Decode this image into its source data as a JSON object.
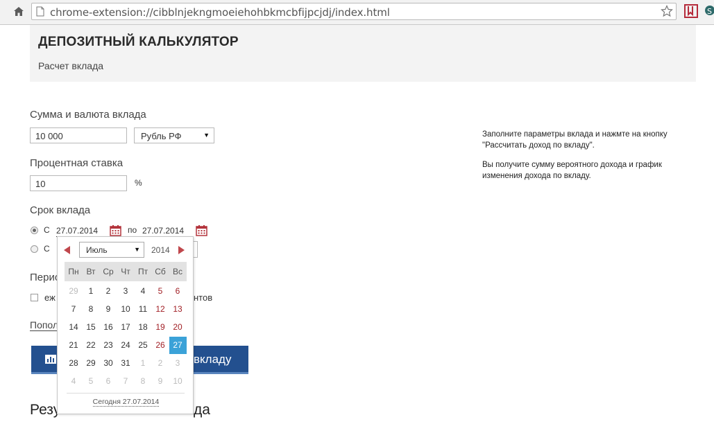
{
  "browser": {
    "url": "chrome-extension://cibblnjekngmoeiehohbkmcbfijpcjdj/index.html",
    "icons": [
      "home-icon",
      "page-icon",
      "star-icon",
      "bookmark-ext-icon",
      "extension-icon"
    ]
  },
  "header": {
    "title": "ДЕПОЗИТНЫЙ КАЛЬКУЛЯТОР",
    "subtitle": "Расчет вклада"
  },
  "form": {
    "amount_label": "Сумма и валюта вклада",
    "amount_value": "10 000",
    "currency_value": "Рубль РФ",
    "rate_label": "Процентная ставка",
    "rate_value": "10",
    "rate_unit": "%",
    "term_label": "Срок вклада",
    "term_from_label": "С",
    "term_from_date": "27.07.2014",
    "term_to_label": "по",
    "term_to_date": "27.07.2014",
    "term_alt_label": "С",
    "period_label_partial": "Перио",
    "monthly_partial": "еж",
    "monthly_tail": "нтов",
    "extra_link_partial": "Попол",
    "calc_button_partial": "вкладу",
    "results_partial_left": "Резу",
    "results_partial_right": "да"
  },
  "sidebar": {
    "hint1": "Заполните параметры вклада и нажмте на кнопку \"Рассчитать доход по вкладу\".",
    "hint2": "Вы получите сумму вероятного дохода и график изменения дохода по вкладу."
  },
  "datepicker": {
    "month": "Июль",
    "year": "2014",
    "weekdays": [
      "Пн",
      "Вт",
      "Ср",
      "Чт",
      "Пт",
      "Сб",
      "Вс"
    ],
    "weeks": [
      [
        "29",
        "1",
        "2",
        "3",
        "4",
        "5",
        "6"
      ],
      [
        "7",
        "8",
        "9",
        "10",
        "11",
        "12",
        "13"
      ],
      [
        "14",
        "15",
        "16",
        "17",
        "18",
        "19",
        "20"
      ],
      [
        "21",
        "22",
        "23",
        "24",
        "25",
        "26",
        "27"
      ],
      [
        "28",
        "29",
        "30",
        "31",
        "1",
        "2",
        "3"
      ],
      [
        "4",
        "5",
        "6",
        "7",
        "8",
        "9",
        "10"
      ]
    ],
    "selected": "27",
    "today_label": "Сегодня 27.07.2014"
  },
  "colors": {
    "accent_blue": "#23508f",
    "selected_day": "#3ba2d8",
    "weekend_red": "#a11f25",
    "arrow_red": "#c0474c"
  }
}
